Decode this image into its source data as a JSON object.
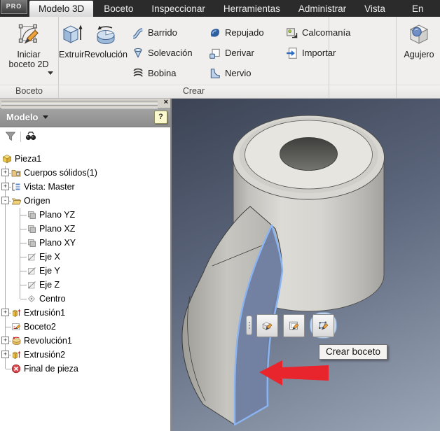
{
  "colors": {
    "viewport_top": "#3b4354",
    "viewport_mid": "#5d677d",
    "viewport_bottom": "#9aa5b6",
    "face_highlight": "#6d7ca0",
    "edge_highlight": "#8ab4f2",
    "arrow_red": "#e8242c",
    "tab_bar_bg": "#2b2b2b",
    "ribbon_bg": "#f0efed",
    "panel_header_bg": "#a4a4a4"
  },
  "tab_bar": {
    "badge": "PRO",
    "tabs": [
      {
        "label": "Modelo 3D",
        "active": true
      },
      {
        "label": "Boceto",
        "active": false
      },
      {
        "label": "Inspeccionar",
        "active": false
      },
      {
        "label": "Herramientas",
        "active": false
      },
      {
        "label": "Administrar",
        "active": false
      },
      {
        "label": "Vista",
        "active": false
      },
      {
        "label": "En",
        "active": false
      }
    ]
  },
  "ribbon": {
    "groups": [
      {
        "label": "Boceto",
        "buttons": [
          {
            "label": "Iniciar boceto 2D",
            "icon": "start-2d-sketch-icon",
            "dropdown": true
          }
        ]
      },
      {
        "label": "Crear",
        "buttons": [
          {
            "label": "Extruir",
            "icon": "extrude-icon"
          },
          {
            "label": "Revolución",
            "icon": "revolve-icon"
          }
        ],
        "columns": [
          [
            {
              "label": "Barrido",
              "icon": "sweep-icon"
            },
            {
              "label": "Solevación",
              "icon": "loft-icon"
            },
            {
              "label": "Bobina",
              "icon": "coil-icon"
            }
          ],
          [
            {
              "label": "Repujado",
              "icon": "emboss-icon"
            },
            {
              "label": "Derivar",
              "icon": "derive-icon"
            },
            {
              "label": "Nervio",
              "icon": "rib-icon"
            }
          ],
          [
            {
              "label": "Calcomanía",
              "icon": "decal-icon"
            },
            {
              "label": "Importar",
              "icon": "import-icon"
            }
          ]
        ]
      },
      {
        "label": "",
        "buttons": []
      },
      {
        "label": "",
        "buttons": [
          {
            "label": "Agujero",
            "icon": "hole-icon"
          }
        ]
      }
    ]
  },
  "browser_panel": {
    "close": "×",
    "header": {
      "title": "Modelo",
      "help": "?"
    },
    "tools": [
      {
        "icon": "filter-icon"
      },
      {
        "icon": "find-icon"
      }
    ],
    "tree": [
      {
        "label": "Pieza1",
        "icon": "part-icon",
        "level": 0,
        "expander": null
      },
      {
        "label": "Cuerpos sólidos(1)",
        "icon": "solid-bodies-icon",
        "level": 1,
        "expander": "+"
      },
      {
        "label": "Vista: Master",
        "icon": "view-rep-icon",
        "level": 1,
        "expander": "+"
      },
      {
        "label": "Origen",
        "icon": "origin-folder-icon",
        "level": 1,
        "expander": "-"
      },
      {
        "label": "Plano YZ",
        "icon": "plane-icon",
        "level": 2,
        "expander": null
      },
      {
        "label": "Plano XZ",
        "icon": "plane-icon",
        "level": 2,
        "expander": null
      },
      {
        "label": "Plano XY",
        "icon": "plane-icon",
        "level": 2,
        "expander": null
      },
      {
        "label": "Eje X",
        "icon": "axis-icon",
        "level": 2,
        "expander": null
      },
      {
        "label": "Eje Y",
        "icon": "axis-icon",
        "level": 2,
        "expander": null
      },
      {
        "label": "Eje Z",
        "icon": "axis-icon",
        "level": 2,
        "expander": null
      },
      {
        "label": "Centro",
        "icon": "center-point-icon",
        "level": 2,
        "expander": null
      },
      {
        "label": "Extrusión1",
        "icon": "extrusion-icon",
        "level": 1,
        "expander": "+"
      },
      {
        "label": "Boceto2",
        "icon": "sketch-icon",
        "level": 1,
        "expander": null
      },
      {
        "label": "Revolución1",
        "icon": "revolution-icon",
        "level": 1,
        "expander": "+"
      },
      {
        "label": "Extrusión2",
        "icon": "extrusion-icon",
        "level": 1,
        "expander": "+"
      },
      {
        "label": "Final de pieza",
        "icon": "end-of-part-icon",
        "level": 1,
        "expander": null
      }
    ]
  },
  "viewport": {
    "tooltip": "Crear boceto",
    "mini_toolbar": {
      "buttons": [
        {
          "icon": "edit-feature-icon",
          "highlighted": false
        },
        {
          "icon": "edit-sketch-icon",
          "highlighted": false
        },
        {
          "icon": "create-sketch-icon",
          "highlighted": true
        }
      ]
    }
  }
}
